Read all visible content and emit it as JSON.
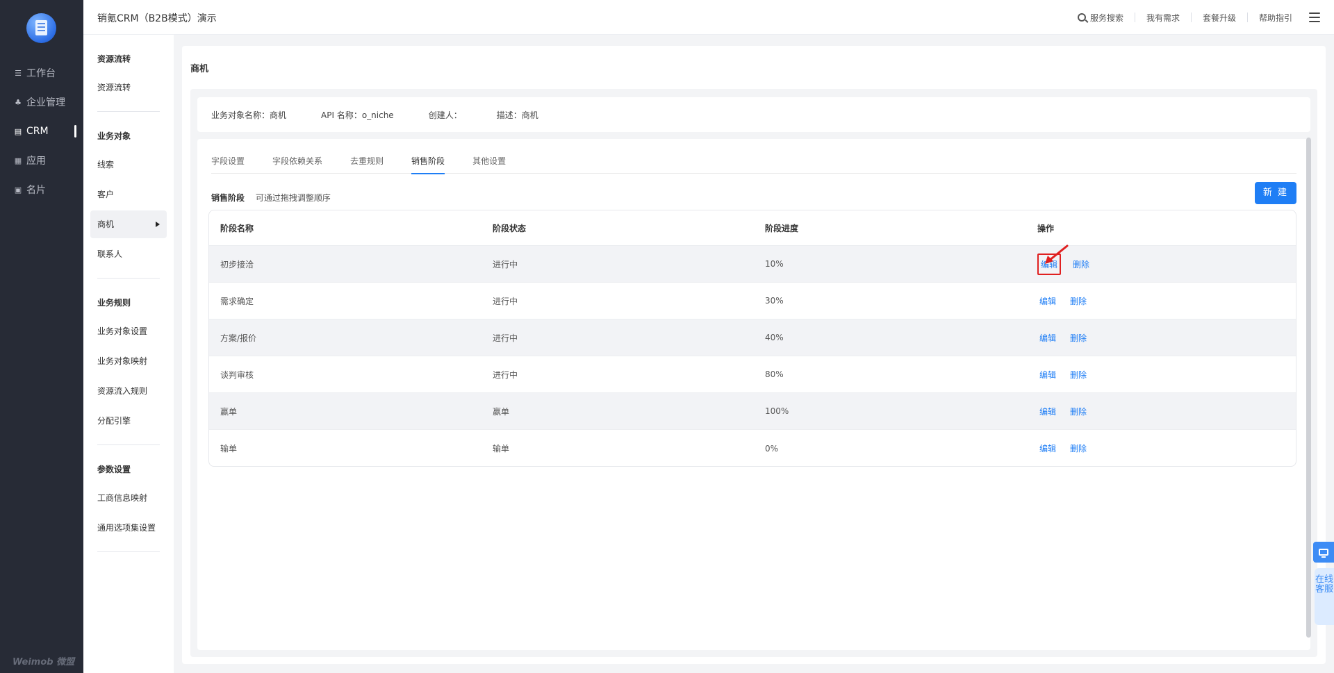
{
  "app": {
    "title": "销氪CRM（B2B模式）演示",
    "brand": "Weimob 微盟"
  },
  "nav": [
    {
      "label": "工作台",
      "icon": "workbench-icon"
    },
    {
      "label": "企业管理",
      "icon": "org-icon"
    },
    {
      "label": "CRM",
      "icon": "crm-icon",
      "active": true
    },
    {
      "label": "应用",
      "icon": "apps-icon"
    },
    {
      "label": "名片",
      "icon": "card-icon"
    }
  ],
  "header": {
    "search": "服务搜索",
    "needs": "我有需求",
    "upgrade": "套餐升级",
    "help": "帮助指引"
  },
  "subnav": {
    "g1": "资源流转",
    "g1_items": [
      "资源流转"
    ],
    "g2": "业务对象",
    "g2_items": [
      "线索",
      "客户",
      "商机",
      "联系人"
    ],
    "g3": "业务规则",
    "g3_items": [
      "业务对象设置",
      "业务对象映射",
      "资源流入规则",
      "分配引擎"
    ],
    "g4": "参数设置",
    "g4_items": [
      "工商信息映射",
      "通用选项集设置"
    ]
  },
  "page": {
    "title": "商机",
    "info": {
      "name": "业务对象名称：商机",
      "api": "API 名称：o_niche",
      "creator": "创建人：",
      "desc": "描述：商机"
    },
    "tabs": [
      "字段设置",
      "字段依赖关系",
      "去重规则",
      "销售阶段",
      "其他设置"
    ],
    "stage_heading": "销售阶段",
    "stage_tip": "可通过拖拽调整顺序",
    "new_button": "新 建"
  },
  "table": {
    "columns": [
      "阶段名称",
      "阶段状态",
      "阶段进度",
      "操作"
    ],
    "rows": [
      {
        "name": "初步接洽",
        "status": "进行中",
        "progress": "10%"
      },
      {
        "name": "需求确定",
        "status": "进行中",
        "progress": "30%"
      },
      {
        "name": "方案/报价",
        "status": "进行中",
        "progress": "40%"
      },
      {
        "name": "谈判审核",
        "status": "进行中",
        "progress": "80%"
      },
      {
        "name": "赢单",
        "status": "赢单",
        "progress": "100%"
      },
      {
        "name": "输单",
        "status": "输单",
        "progress": "0%"
      }
    ],
    "edit": "编辑",
    "delete": "删除"
  },
  "float": {
    "cs": "在线客服"
  },
  "colors": {
    "accent": "#1f7ef5",
    "sidebar": "#272b36",
    "highlight": "#e02020"
  }
}
